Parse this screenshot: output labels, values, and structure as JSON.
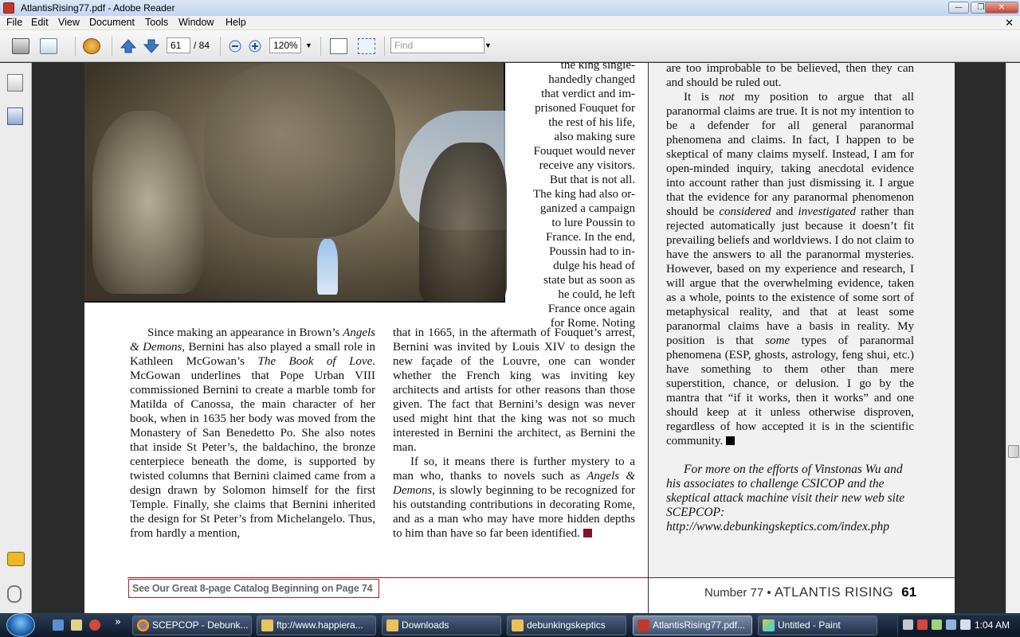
{
  "window": {
    "title": "AtlantisRising77.pdf - Adobe Reader",
    "controls": {
      "minimize": "—",
      "maximize": "❐",
      "close": "✕"
    }
  },
  "menu": {
    "items": [
      "File",
      "Edit",
      "View",
      "Document",
      "Tools",
      "Window",
      "Help"
    ],
    "doc_close": "✕"
  },
  "toolbar": {
    "current_page": "61",
    "page_total": "/ 84",
    "zoom": "120%",
    "find_placeholder": "Find"
  },
  "document": {
    "wrap_lines": [
      "the king single-",
      "handedly changed",
      "that verdict and im-",
      "prisoned Fouquet for",
      "the rest of his life,",
      "also making sure",
      "Fouquet would never",
      "receive any visitors.",
      "But that is not all.",
      "The king had also or-",
      "ganized a campaign",
      "to lure Poussin to",
      "France. In the end,",
      "Poussin had to in-",
      "dulge his head of",
      "state but as soon as",
      "he could, he left",
      "France once again",
      "for Rome. Noting"
    ],
    "col1": {
      "p1_a": "Since making an appearance in Brown’s ",
      "p1_angels": "Angels & Demons",
      "p1_b": ", Bernini has also played a small role in Kathleen McGowan’s ",
      "p1_book": "The Book of Love",
      "p1_c": ". McGowan underlines that Pope Urban VIII commissioned Bernini to create a marble tomb for Matilda of Canossa, the main character of her book, when in 1635 her body was moved from the Monastery of San Benedetto Po. She also notes that inside St Peter’s, the baldachino, the bronze centerpiece beneath the dome, is supported by twisted columns that Bernini claimed came from a design drawn by Solomon himself for the first Temple. Finally, she claims that Bernini inherited the design for St Peter’s from Michelangelo. Thus, from hardly a mention,"
    },
    "col2": {
      "p1": "that in 1665, in the aftermath of Fouquet’s arrest, Bernini was invited by Louis XIV to design the new façade of the Louvre, one can wonder whether the French king was inviting key architects and artists for other reasons than those given. The fact that Bernini’s design was never used might hint that the king was not so much interested in Bernini the architect, as Bernini the man.",
      "p2_a": "If so, it means there is further mystery to a man who, thanks to novels such as ",
      "p2_angels": "Angels & Demons",
      "p2_b": ", is slowly beginning to be recognized for his outstanding contributions in decorating Rome, and as a man who may have more hidden depths to him than have so far been identified."
    },
    "col3": {
      "p0": "are too improbable to be believed, then they can and should be ruled out.",
      "p1_a": "It is ",
      "p1_not": "not",
      "p1_b": " my position to argue that all paranormal claims are true. It is not my intention to be a defender for all general paranormal phenomena and claims. In fact, I happen to be skeptical of many claims myself. Instead, I am for open-minded inquiry, taking anecdotal evidence into account rather than just dismissing it. I argue that the evidence for any paranormal phenomenon should be ",
      "p1_considered": "considered",
      "p1_and": " and ",
      "p1_investigated": "investigated",
      "p1_c": " rather than rejected automatically just because it doesn’t fit prevailing beliefs and worldviews. I do not claim to have the answers to all the paranormal mysteries. However, based on my experience and research, I will argue that the overwhelming evidence, taken as a whole, points to the existence of some sort of metaphysical reality, and that at least some paranormal claims have a basis in reality. My position is that ",
      "p1_some": "some",
      "p1_d": " types of paranormal phenomena (ESP, ghosts, astrology, feng shui, etc.) have something to them other than mere superstition, chance, or delusion. I go by the mantra that “if it works, then it works” and one should keep at it unless otherwise disproven, regardless of how accepted it is in the scientific community.",
      "note": "For more on the efforts of Vinstonas Wu and his associates to challenge CSICOP and the skeptical attack machine visit their new web site SCEPCOP: http://www.debunkingskeptics.com/index.php"
    },
    "footer": {
      "catalog": "See Our Great 8-page Catalog Beginning on Page 74",
      "issue_number": "Number 77",
      "bullet": "•",
      "magazine": "ATLANTIS RISING",
      "page_num": "61"
    }
  },
  "taskbar": {
    "items": [
      {
        "label": "SCEPCOP - Debunk...",
        "icon": "chrome-icon"
      },
      {
        "label": "ftp://www.happiera...",
        "icon": "folder-icon"
      },
      {
        "label": "Downloads",
        "icon": "folder-icon"
      },
      {
        "label": "debunkingskeptics",
        "icon": "folder-icon"
      },
      {
        "label": "AtlantisRising77.pdf...",
        "icon": "pdf-icon",
        "active": true
      },
      {
        "label": "Untitled - Paint",
        "icon": "paint-icon"
      }
    ],
    "clock": "1:04 AM",
    "overflow": "»"
  },
  "colors": {
    "accent_red": "#7a1428",
    "taskbar": "#1a2a40"
  }
}
